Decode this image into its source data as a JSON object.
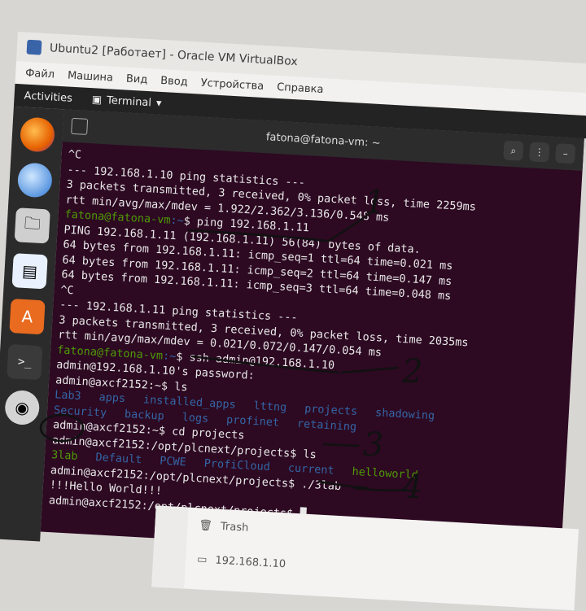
{
  "vbox": {
    "title": "Ubuntu2 [Работает] - Oracle VM VirtualBox",
    "menu": [
      "Файл",
      "Машина",
      "Вид",
      "Ввод",
      "Устройства",
      "Справка"
    ]
  },
  "topbar": {
    "activities": "Activities",
    "app": "Terminal"
  },
  "terminal": {
    "title": "fatona@fatona-vm: ~",
    "lines": [
      "^C",
      "--- 192.168.1.10 ping statistics ---",
      "3 packets transmitted, 3 received, 0% packet loss, time 2259ms",
      "rtt min/avg/max/mdev = 1.922/2.362/3.136/0.548 ms",
      "PING 192.168.1.11 (192.168.1.11) 56(84) bytes of data.",
      "64 bytes from 192.168.1.11: icmp_seq=1 ttl=64 time=0.021 ms",
      "64 bytes from 192.168.1.11: icmp_seq=2 ttl=64 time=0.147 ms",
      "64 bytes from 192.168.1.11: icmp_seq=3 ttl=64 time=0.048 ms",
      "^C",
      "--- 192.168.1.11 ping statistics ---",
      "3 packets transmitted, 3 received, 0% packet loss, time 2035ms",
      "rtt min/avg/max/mdev = 0.021/0.072/0.147/0.054 ms",
      "admin@192.168.1.10's password:",
      "admin@axcf2152:~$ ls",
      "admin@axcf2152:~$ cd projects",
      "admin@axcf2152:/opt/plcnext/projects$ ls",
      "admin@axcf2152:/opt/plcnext/projects$ ./3lab",
      "!!!Hello World!!!",
      "admin@axcf2152:/opt/plcnext/projects$"
    ],
    "prompt_user": "fatona@fatona-vm",
    "prompt_path": ":~",
    "cmd_ping": "$ ping 192.168.1.11",
    "cmd_ssh": "$ ssh admin@192.168.1.10",
    "ls1": [
      "Lab3",
      "apps",
      "installed_apps",
      "lttng",
      "projects",
      "shadowing",
      "Security",
      "backup",
      "logs",
      "profinet",
      "retaining"
    ],
    "ls2": [
      "3lab",
      "Default",
      "PCWE",
      "ProfiCloud",
      "current",
      "helloworld"
    ]
  },
  "nautilus": {
    "items": [
      "Trash",
      "192.168.1.10"
    ]
  },
  "annotations": [
    "1",
    "2",
    "3",
    "4"
  ],
  "colors": {
    "terminal_bg": "#2d0922",
    "prompt": "#4e9a06",
    "dir": "#3465a4"
  }
}
